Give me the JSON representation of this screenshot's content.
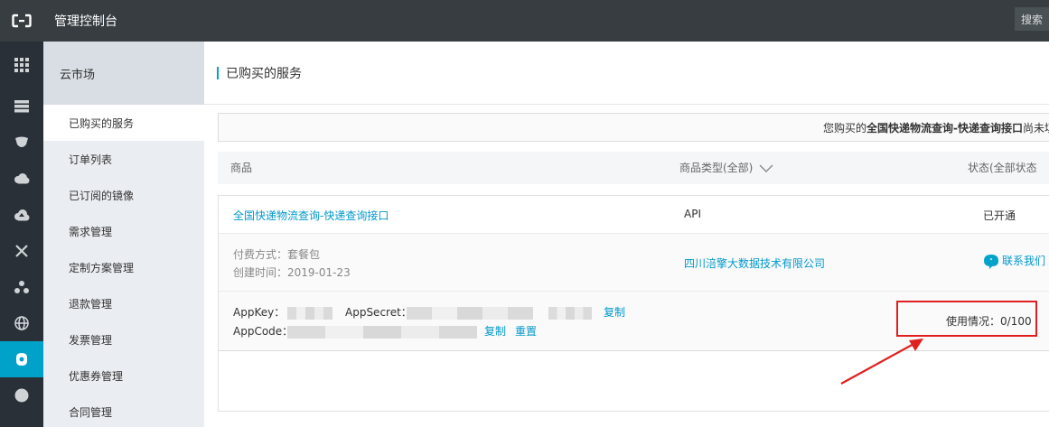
{
  "app": {
    "title": "管理控制台",
    "search_label": "搜索"
  },
  "rail": {
    "icons": [
      "apps-grid-icon",
      "database-icon",
      "shield-icon",
      "cloud-icon",
      "cloud-upload-icon",
      "network-icon",
      "cluster-icon",
      "globe-icon",
      "market-icon",
      "circle-icon"
    ],
    "active_index": 8
  },
  "subnav": {
    "header": "云市场",
    "items": [
      {
        "label": "已购买的服务",
        "active": true
      },
      {
        "label": "订单列表"
      },
      {
        "label": "已订阅的镜像"
      },
      {
        "label": "需求管理"
      },
      {
        "label": "定制方案管理"
      },
      {
        "label": "退款管理"
      },
      {
        "label": "发票管理"
      },
      {
        "label": "优惠券管理"
      },
      {
        "label": "合同管理"
      }
    ]
  },
  "main": {
    "title": "已购买的服务",
    "notice": {
      "prefix": "您购买的",
      "product": "全国快递物流查询-快递查询接口",
      "suffix": "尚未填写"
    },
    "columns": {
      "product": "商品",
      "type": "商品类型(全部)",
      "status": "状态(全部状态"
    },
    "row": {
      "product_name": "全国快递物流查询-快递查询接口",
      "type": "API",
      "status": "已开通",
      "payment": "付费方式：套餐包",
      "created": "创建时间：2019-01-23",
      "vendor": "四川涪擎大数据技术有限公司",
      "contact": "联系我们",
      "appkey_label": "AppKey：",
      "appsecret_label": "AppSecret：",
      "appcode_label": "AppCode：",
      "copy_label": "复制",
      "reset_label": "重置",
      "usage": "使用情况：0/100"
    }
  },
  "colors": {
    "accent": "#00a2ca",
    "link": "#0099cc",
    "highlight": "#e02020",
    "topbar": "#373d41",
    "rail": "#293038"
  }
}
